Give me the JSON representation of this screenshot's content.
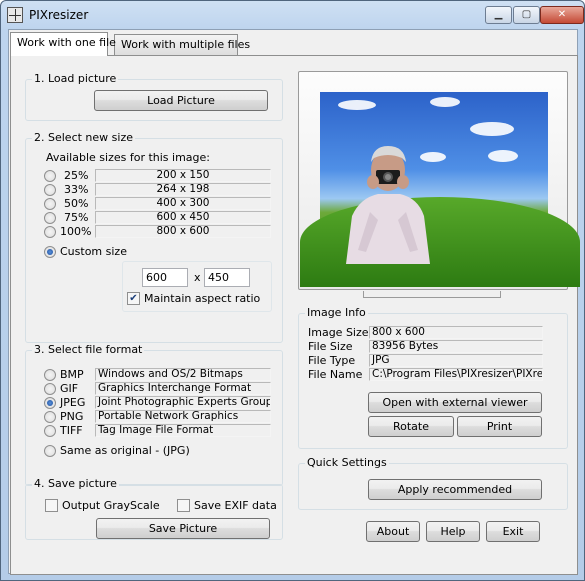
{
  "window": {
    "title": "PIXresizer",
    "minimize": "▁",
    "maximize": "▢",
    "close": "✕"
  },
  "tabs": [
    {
      "label": "Work with one file",
      "active": true
    },
    {
      "label": "Work with multiple files",
      "active": false
    }
  ],
  "load": {
    "title": "1. Load picture",
    "button": "Load Picture"
  },
  "size": {
    "title": "2. Select new size",
    "available": "Available sizes for this image:",
    "options": [
      {
        "pct": "25%",
        "dims": "200 x 150"
      },
      {
        "pct": "33%",
        "dims": "264 x 198"
      },
      {
        "pct": "50%",
        "dims": "400 x 300"
      },
      {
        "pct": "75%",
        "dims": "600 x 450"
      },
      {
        "pct": "100%",
        "dims": "800 x 600"
      }
    ],
    "custom_label": "Custom size",
    "width": "600",
    "x": "x",
    "height": "450",
    "aspect_label": "Maintain aspect ratio",
    "aspect_checked": true
  },
  "format": {
    "title": "3. Select file format",
    "options": [
      {
        "ext": "BMP",
        "desc": "Windows and OS/2 Bitmaps"
      },
      {
        "ext": "GIF",
        "desc": "Graphics Interchange Format"
      },
      {
        "ext": "JPEG",
        "desc": "Joint Photographic Experts Group"
      },
      {
        "ext": "PNG",
        "desc": "Portable Network Graphics"
      },
      {
        "ext": "TIFF",
        "desc": "Tag Image File Format"
      }
    ],
    "selected": "JPEG",
    "same_label": "Same as original  - (JPG)"
  },
  "save": {
    "title": "4. Save picture",
    "grayscale": "Output GrayScale",
    "exif": "Save EXIF data",
    "button": "Save Picture"
  },
  "info": {
    "title": "Image Info",
    "rows": [
      {
        "label": "Image Size",
        "value": "800 x 600"
      },
      {
        "label": "File Size",
        "value": "83956 Bytes"
      },
      {
        "label": "File Type",
        "value": "JPG"
      },
      {
        "label": "File Name",
        "value": "C:\\Program Files\\PIXresizer\\PIXresiz"
      }
    ],
    "open_button": "Open with external viewer",
    "rotate_button": "Rotate",
    "print_button": "Print"
  },
  "quick": {
    "title": "Quick Settings",
    "button": "Apply recommended"
  },
  "footer": {
    "about": "About",
    "help": "Help",
    "exit": "Exit"
  }
}
